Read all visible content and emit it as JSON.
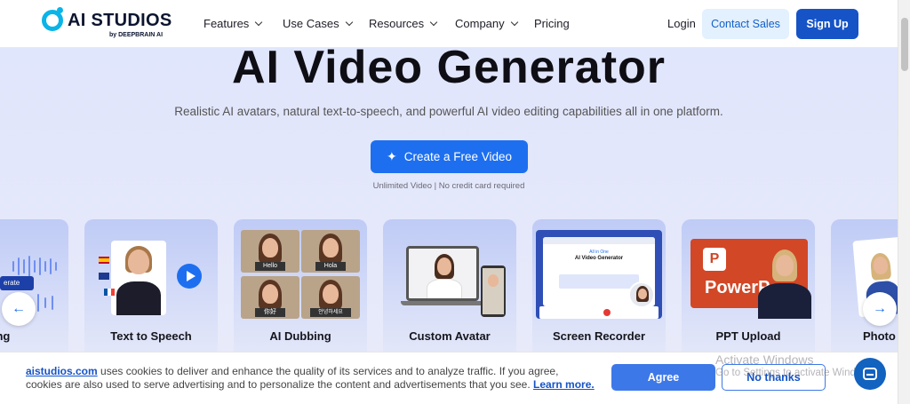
{
  "header": {
    "logo_text": "AI STUDIOS",
    "logo_sub": "by DEEPBRAIN AI",
    "nav": [
      "Features",
      "Use Cases",
      "Resources",
      "Company",
      "Pricing"
    ],
    "login": "Login",
    "contact_sales": "Contact Sales",
    "sign_up": "Sign Up"
  },
  "hero": {
    "title": "AI Video Generator",
    "subtitle": "Realistic AI avatars, natural text-to-speech, and powerful AI video editing capabilities all in one platform.",
    "cta": "Create a Free Video",
    "cta_note": "Unlimited Video | No credit card required"
  },
  "cards": [
    "Cloning",
    "Text to Speech",
    "AI Dubbing",
    "Custom Avatar",
    "Screen Recorder",
    "PPT Upload",
    "Photo A"
  ],
  "card_details": {
    "cloning_chip": "erate",
    "dubbing_labels": [
      "Hello",
      "Hola",
      "你好",
      "안녕하세요"
    ],
    "recorder_headline_1": "All in One",
    "recorder_headline_2": "AI Video Generator",
    "ppt_text": "PowerP"
  },
  "cookie": {
    "link": "aistudios.com",
    "text": " uses cookies to deliver and enhance the quality of its services and to analyze traffic. If you agree, cookies are also used to serve advertising and to personalize the content and advertisements that you see. ",
    "learn_more": "Learn more.",
    "agree": "Agree",
    "no_thanks": "No thanks"
  },
  "watermark": {
    "line1": "Activate Windows",
    "line2": "Go to Settings to activate Windows."
  },
  "colors": {
    "primary": "#1d6ff0",
    "signup": "#1553c7",
    "logo": "#0ab4e8"
  }
}
